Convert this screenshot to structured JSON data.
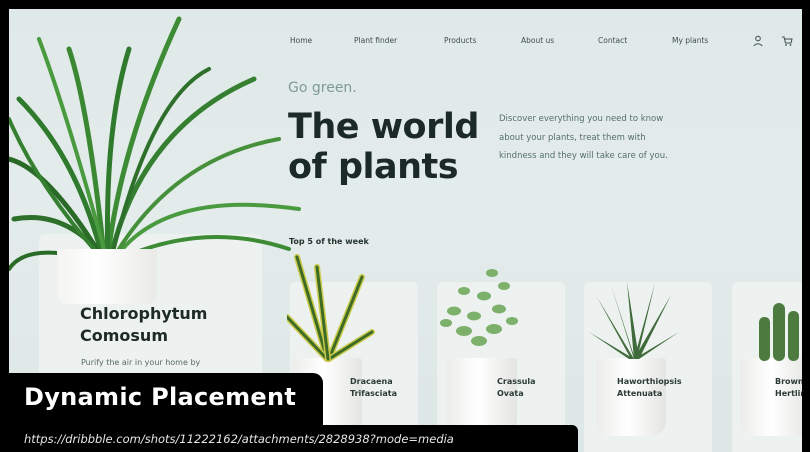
{
  "nav": {
    "items": [
      "Home",
      "Plant finder",
      "Products",
      "About us",
      "Contact",
      "My plants"
    ],
    "account_icon": "user-icon",
    "cart_icon": "cart-icon"
  },
  "hero": {
    "tagline": "Go green.",
    "title_line1": "The world",
    "title_line2": "of plants",
    "description": "Discover everything you need to know about your plants, treat them with kindness and they will take care of you."
  },
  "featured": {
    "name_line1": "Chlorophytum",
    "name_line2": "Comosum",
    "description": "Purify the air in your home by"
  },
  "section_title": "Top 5 of the week",
  "products": [
    {
      "line1": "Dracaena",
      "line2": "Trifasciata"
    },
    {
      "line1": "Crassula",
      "line2": "Ovata"
    },
    {
      "line1": "Haworthiopsis",
      "line2": "Attenuata"
    },
    {
      "line1": "Browni",
      "line2": "Hertling"
    }
  ],
  "overlay": {
    "title": "Dynamic Placement",
    "url": "https://dribbble.com/shots/11222162/attachments/2828938?mode=media"
  },
  "colors": {
    "background": "#e0eae9",
    "accent": "#7f9b93",
    "text_dark": "#1b2a28"
  }
}
